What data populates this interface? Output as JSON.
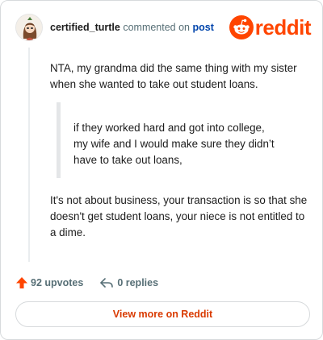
{
  "header": {
    "username": "certified_turtle",
    "action_text": "commented on",
    "post_link": "post",
    "brand": "reddit"
  },
  "comment": {
    "paragraph1": "NTA, my grandma did the same thing with my sister when she wanted to take out student loans.",
    "quote_lines": [
      "if they worked hard and got into college,",
      "my wife and I would make sure they didn’t",
      "have to take out loans,"
    ],
    "paragraph2": "It's not about business, your transaction is so that she doesn't get student loans, your niece is not entitled to a dime."
  },
  "actions": {
    "upvotes": "92 upvotes",
    "replies": "0 replies"
  },
  "cta": {
    "label": "View more on Reddit"
  },
  "colors": {
    "brand": "#ff4500",
    "cta_text": "#d93a00",
    "link": "#0045ac",
    "muted": "#576f76"
  },
  "icons": {
    "avatar": "avatar",
    "logo": "snoo-icon",
    "upvote": "upvote-arrow-icon",
    "reply": "reply-arrow-icon"
  }
}
